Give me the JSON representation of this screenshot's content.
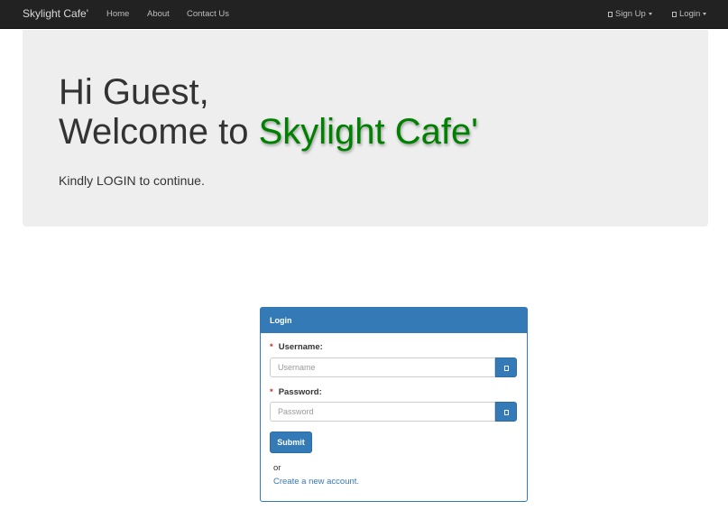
{
  "navbar": {
    "brand": "Skylight Cafe'",
    "links": [
      {
        "label": "Home"
      },
      {
        "label": "About"
      },
      {
        "label": "Contact Us"
      }
    ],
    "right": {
      "signup_label": "Sign Up",
      "login_label": "Login"
    }
  },
  "hero": {
    "greeting": "Hi Guest,",
    "welcome_prefix": "Welcome to ",
    "cafe_name": "Skylight Cafe'",
    "subtext": "Kindly LOGIN to continue."
  },
  "login_panel": {
    "title": "Login",
    "required_marker": "*",
    "username_label": "Username:",
    "username_placeholder": "Username",
    "username_value": "",
    "password_label": "Password:",
    "password_placeholder": "Password",
    "password_value": "",
    "submit_label": "Submit",
    "or_text": "or",
    "create_account_text": "Create a new account."
  },
  "colors": {
    "navbar_bg": "#222222",
    "jumbotron_bg": "#eeeeee",
    "brand_green": "#008000",
    "primary_blue": "#337ab7",
    "required_red": "#c9302c"
  },
  "icons": {
    "signup": "user-icon",
    "login": "log-in-icon",
    "username_addon": "user-icon",
    "password_addon": "lock-icon"
  }
}
